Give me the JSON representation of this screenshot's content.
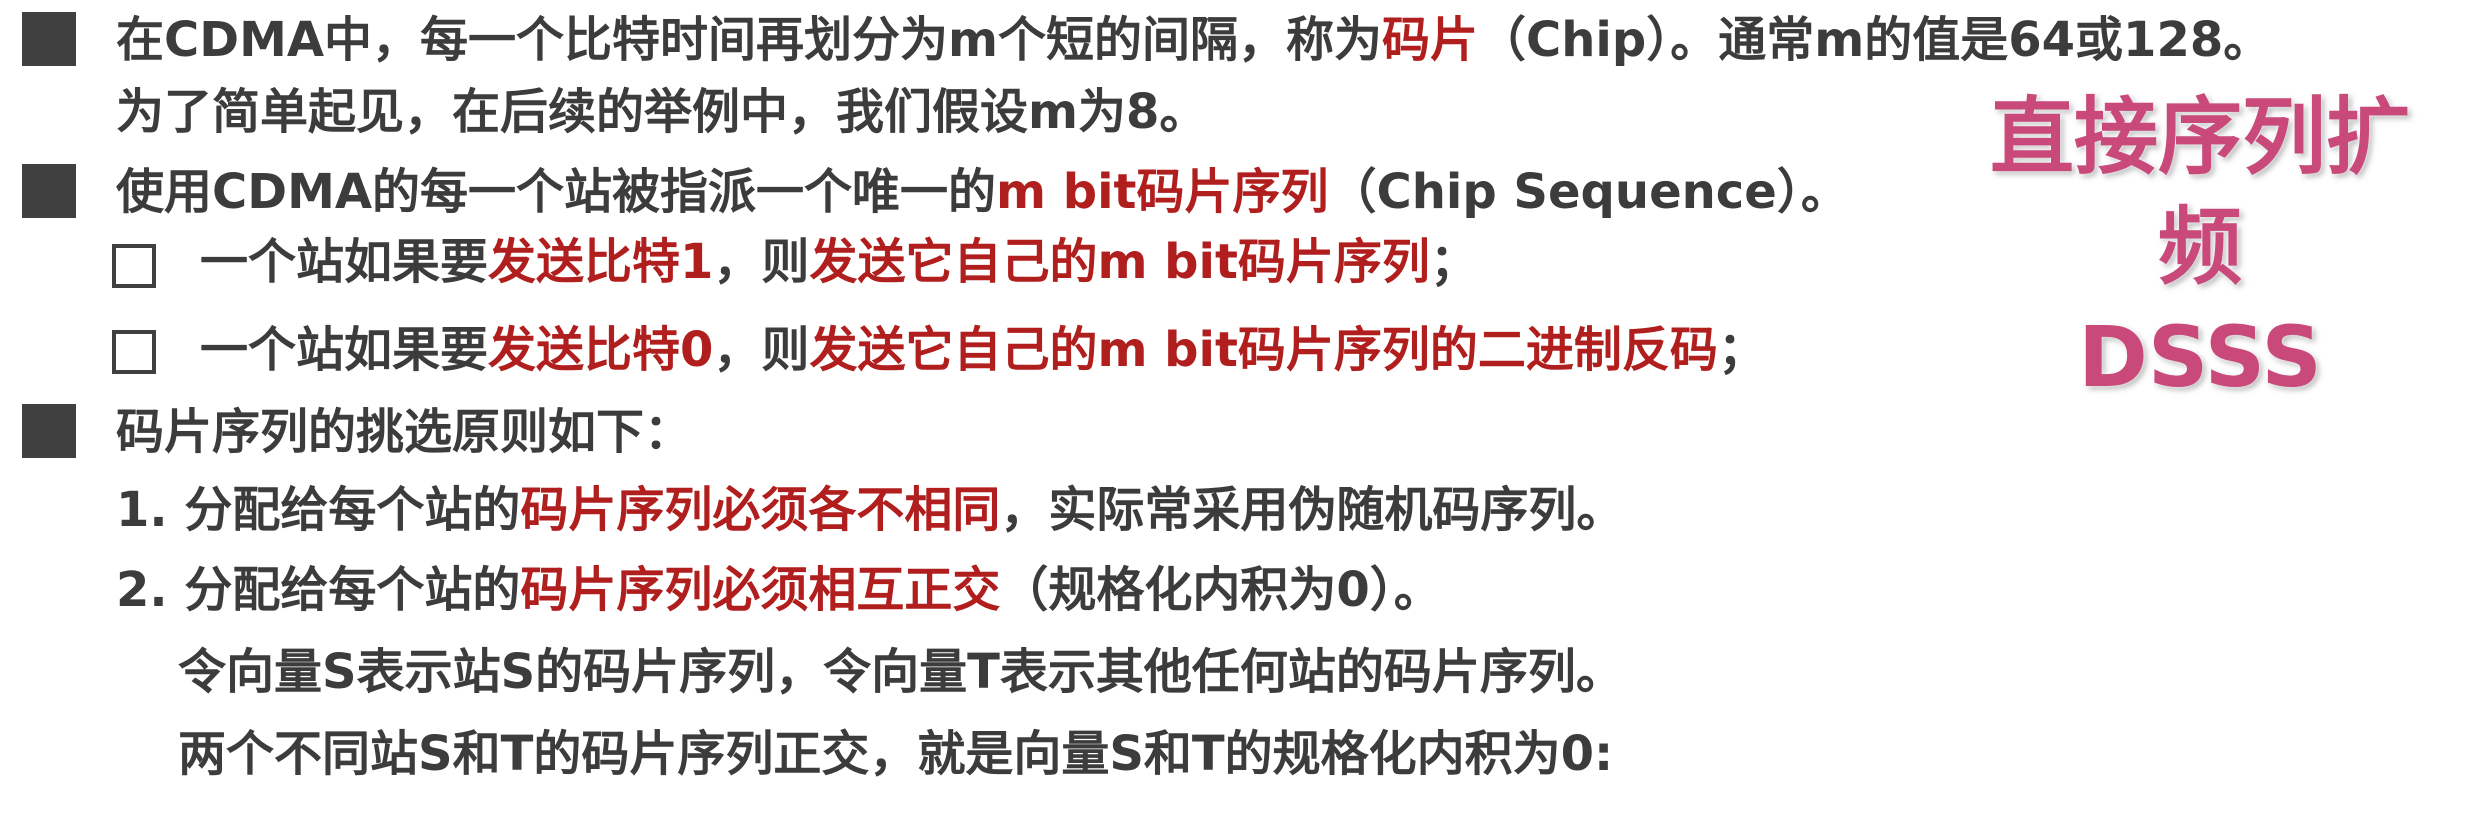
{
  "colors": {
    "text": "#3c3c3c",
    "highlight": "#b01e1e",
    "title": "#c8497a",
    "bullet": "#404040"
  },
  "side_title": {
    "line1": "直接序列扩频",
    "line2": "DSSS"
  },
  "p1": {
    "a": "在CDMA中，每一个比特时间再划分为m个短的间隔，称为",
    "b": "码片",
    "c": "（Chip）。通常m的值是64或128。",
    "line2": "为了简单起见，在后续的举例中，我们假设m为8。"
  },
  "p2": {
    "a": "使用CDMA的每一个站被指派一个唯一的",
    "b": "m bit码片序列",
    "c": "（Chip Sequence）。"
  },
  "sub1": {
    "a": "一个站如果要",
    "b": "发送比特1",
    "c": "，则",
    "d": "发送它自己的m bit码片序列",
    "e": "；"
  },
  "sub2": {
    "a": "一个站如果要",
    "b": "发送比特0",
    "c": "，则",
    "d": "发送它自己的m bit码片序列的二进制反码",
    "e": "；"
  },
  "p3": {
    "text": "码片序列的挑选原则如下："
  },
  "rule1": {
    "a": "1. 分配给每个站的",
    "b": "码片序列必须各不相同",
    "c": "，实际常采用伪随机码序列。"
  },
  "rule2": {
    "a": "2. 分配给每个站的",
    "b": "码片序列必须相互正交",
    "c": "（规格化内积为0）。",
    "line2": "令向量S表示站S的码片序列，令向量T表示其他任何站的码片序列。",
    "line3": "两个不同站S和T的码片序列正交，就是向量S和T的规格化内积为0:"
  }
}
